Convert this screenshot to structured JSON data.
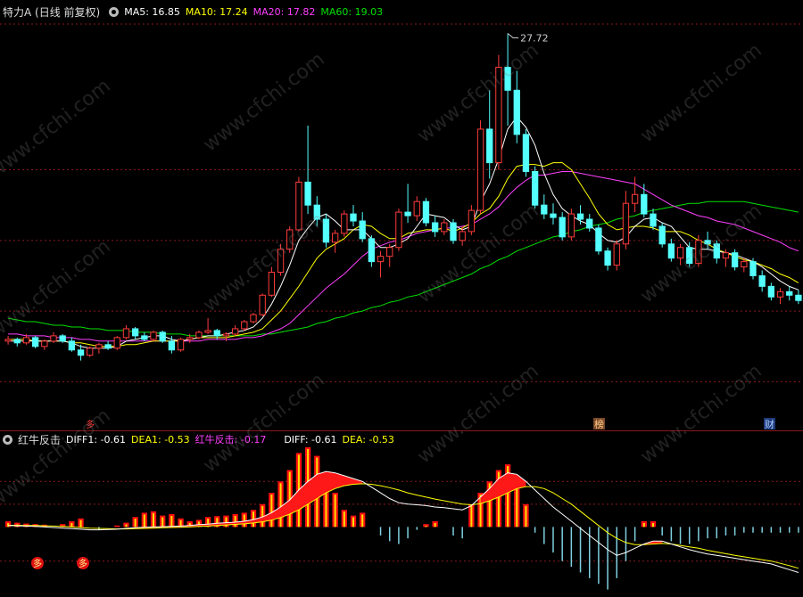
{
  "main_legend": {
    "title": "特力A (日线 前复权)",
    "ma5": "MA5: 16.85",
    "ma10": "MA10: 17.24",
    "ma20": "MA20: 17.82",
    "ma60": "MA60: 19.03"
  },
  "sub_legend": {
    "title": "红牛反击",
    "diff1": "DIFF1: -0.61",
    "dea1": "DEA1: -0.53",
    "hong": "红牛反击: -0.17",
    "diff": "DIFF: -0.61",
    "dea": "DEA: -0.53"
  },
  "peak_label": "27.72",
  "markers": {
    "bang": "榜",
    "cai": "财",
    "duo": "多"
  },
  "watermark": "www.cfchi.com",
  "colors": {
    "up": "#ff3b3b",
    "down": "#54ffff",
    "ma5": "#ffffff",
    "ma10": "#ffff00",
    "ma20": "#ff40ff",
    "ma60": "#00e000",
    "grid": "#8a1a1a"
  },
  "chart_data": {
    "type": "candlestick",
    "main": {
      "title": "特力A (日线 前复权)",
      "ylim": [
        5.5,
        28.5
      ],
      "peak": 27.72,
      "candles": [
        [
          10.3,
          10.6,
          10.1,
          10.4
        ],
        [
          10.4,
          10.5,
          10.0,
          10.2
        ],
        [
          10.2,
          10.7,
          10.1,
          10.5
        ],
        [
          10.5,
          10.6,
          9.9,
          10.0
        ],
        [
          10.0,
          10.4,
          9.8,
          10.3
        ],
        [
          10.3,
          10.8,
          10.2,
          10.6
        ],
        [
          10.6,
          10.7,
          10.2,
          10.3
        ],
        [
          10.3,
          10.5,
          9.7,
          9.8
        ],
        [
          9.8,
          10.1,
          9.2,
          9.5
        ],
        [
          9.5,
          10.0,
          9.4,
          9.9
        ],
        [
          9.9,
          10.2,
          9.6,
          10.1
        ],
        [
          10.1,
          10.3,
          9.8,
          9.9
        ],
        [
          9.9,
          10.6,
          9.8,
          10.5
        ],
        [
          10.5,
          11.2,
          10.4,
          11.0
        ],
        [
          11.0,
          11.1,
          10.4,
          10.6
        ],
        [
          10.6,
          10.8,
          10.3,
          10.4
        ],
        [
          10.4,
          10.9,
          10.3,
          10.8
        ],
        [
          10.8,
          10.9,
          10.2,
          10.3
        ],
        [
          10.3,
          10.6,
          9.6,
          9.8
        ],
        [
          9.8,
          10.5,
          9.7,
          10.4
        ],
        [
          10.4,
          10.7,
          10.2,
          10.5
        ],
        [
          10.5,
          10.9,
          10.4,
          10.8
        ],
        [
          10.8,
          11.6,
          10.7,
          10.9
        ],
        [
          10.9,
          11.0,
          10.4,
          10.6
        ],
        [
          10.6,
          10.8,
          10.3,
          10.7
        ],
        [
          10.7,
          11.2,
          10.6,
          11.0
        ],
        [
          11.0,
          11.5,
          10.9,
          11.4
        ],
        [
          11.4,
          11.9,
          11.3,
          11.8
        ],
        [
          11.8,
          13.0,
          11.7,
          12.9
        ],
        [
          12.9,
          14.5,
          12.8,
          14.2
        ],
        [
          14.2,
          15.8,
          14.0,
          15.5
        ],
        [
          15.5,
          16.8,
          15.3,
          16.6
        ],
        [
          16.6,
          19.6,
          16.5,
          19.3
        ],
        [
          19.3,
          22.5,
          17.5,
          18.0
        ],
        [
          18.0,
          18.5,
          16.8,
          17.2
        ],
        [
          17.2,
          17.5,
          15.6,
          15.9
        ],
        [
          15.9,
          16.6,
          15.3,
          16.4
        ],
        [
          16.4,
          17.7,
          16.2,
          17.5
        ],
        [
          17.5,
          18.0,
          16.8,
          17.1
        ],
        [
          17.1,
          17.6,
          15.9,
          16.1
        ],
        [
          16.1,
          16.3,
          14.5,
          14.8
        ],
        [
          14.8,
          15.4,
          13.9,
          15.1
        ],
        [
          15.1,
          15.8,
          14.5,
          15.6
        ],
        [
          15.6,
          17.8,
          15.4,
          17.6
        ],
        [
          17.6,
          19.2,
          17.0,
          17.4
        ],
        [
          17.4,
          18.5,
          17.1,
          18.2
        ],
        [
          18.2,
          18.4,
          16.8,
          17.0
        ],
        [
          17.0,
          17.4,
          16.2,
          16.5
        ],
        [
          16.5,
          17.2,
          16.3,
          17.0
        ],
        [
          17.0,
          17.2,
          15.8,
          16.0
        ],
        [
          16.0,
          16.8,
          15.7,
          16.5
        ],
        [
          16.5,
          18.0,
          16.3,
          17.7
        ],
        [
          17.7,
          22.8,
          17.5,
          22.3
        ],
        [
          22.3,
          24.5,
          19.5,
          20.4
        ],
        [
          20.4,
          26.5,
          20.0,
          25.8
        ],
        [
          25.8,
          27.72,
          22.5,
          24.5
        ],
        [
          24.5,
          25.6,
          21.5,
          22.0
        ],
        [
          22.0,
          22.3,
          19.6,
          19.9
        ],
        [
          19.9,
          20.2,
          17.8,
          18.0
        ],
        [
          18.0,
          18.6,
          17.2,
          17.5
        ],
        [
          17.5,
          18.1,
          16.9,
          17.3
        ],
        [
          17.3,
          17.6,
          16.0,
          16.2
        ],
        [
          16.2,
          17.8,
          16.0,
          17.5
        ],
        [
          17.5,
          18.0,
          16.9,
          17.2
        ],
        [
          17.2,
          17.5,
          16.5,
          16.7
        ],
        [
          16.7,
          16.9,
          15.2,
          15.4
        ],
        [
          15.4,
          15.6,
          14.3,
          14.6
        ],
        [
          14.6,
          16.0,
          14.3,
          15.8
        ],
        [
          15.8,
          18.8,
          15.5,
          18.1
        ],
        [
          18.1,
          19.6,
          17.6,
          18.6
        ],
        [
          18.6,
          19.2,
          17.3,
          17.5
        ],
        [
          17.5,
          17.8,
          16.6,
          16.8
        ],
        [
          16.8,
          17.0,
          15.6,
          15.8
        ],
        [
          15.8,
          16.1,
          14.8,
          15.0
        ],
        [
          15.0,
          15.8,
          14.6,
          15.6
        ],
        [
          15.6,
          15.9,
          14.5,
          14.7
        ],
        [
          14.7,
          16.3,
          14.5,
          16.0
        ],
        [
          16.0,
          16.5,
          15.5,
          15.8
        ],
        [
          15.8,
          16.0,
          14.7,
          15.0
        ],
        [
          15.0,
          15.5,
          14.5,
          15.3
        ],
        [
          15.3,
          15.5,
          14.3,
          14.5
        ],
        [
          14.5,
          15.0,
          14.2,
          14.8
        ],
        [
          14.8,
          15.0,
          13.8,
          14.0
        ],
        [
          14.0,
          14.3,
          13.1,
          13.4
        ],
        [
          13.4,
          13.6,
          12.6,
          12.8
        ],
        [
          12.8,
          13.3,
          12.4,
          13.1
        ],
        [
          13.1,
          13.4,
          12.6,
          12.9
        ],
        [
          12.9,
          13.2,
          12.4,
          12.6
        ]
      ],
      "ma5": [
        10.3,
        10.3,
        10.3,
        10.3,
        10.3,
        10.3,
        10.3,
        10.2,
        10.0,
        9.9,
        9.9,
        9.9,
        10.0,
        10.3,
        10.4,
        10.5,
        10.6,
        10.6,
        10.4,
        10.3,
        10.4,
        10.5,
        10.6,
        10.6,
        10.7,
        10.8,
        10.9,
        11.1,
        11.6,
        12.4,
        13.4,
        14.6,
        16.0,
        16.7,
        17.3,
        17.5,
        17.1,
        16.6,
        16.6,
        16.6,
        16.1,
        15.6,
        15.6,
        15.8,
        16.1,
        16.8,
        17.5,
        17.4,
        17.3,
        16.9,
        16.6,
        16.8,
        18.2,
        19.2,
        20.6,
        22.3,
        23.0,
        22.4,
        21.4,
        19.8,
        18.6,
        17.8,
        17.4,
        17.1,
        16.9,
        16.4,
        16.0,
        15.9,
        16.2,
        16.8,
        17.2,
        17.3,
        17.0,
        16.8,
        16.2,
        15.6,
        15.5,
        15.5,
        15.4,
        15.3,
        15.2,
        15.0,
        14.8,
        14.5,
        14.1,
        13.7,
        13.4,
        13.2
      ],
      "ma10": [
        10.4,
        10.4,
        10.4,
        10.3,
        10.3,
        10.3,
        10.3,
        10.2,
        10.2,
        10.1,
        10.0,
        10.0,
        10.0,
        10.1,
        10.1,
        10.2,
        10.3,
        10.3,
        10.3,
        10.3,
        10.4,
        10.5,
        10.5,
        10.5,
        10.5,
        10.6,
        10.7,
        10.8,
        11.0,
        11.5,
        12.0,
        12.7,
        13.4,
        14.2,
        15.0,
        15.5,
        15.8,
        16.1,
        16.6,
        16.9,
        16.8,
        16.4,
        16.1,
        16.1,
        16.4,
        16.5,
        16.6,
        16.6,
        16.7,
        16.5,
        16.7,
        17.0,
        17.5,
        17.8,
        18.5,
        19.5,
        20.2,
        20.3,
        20.3,
        20.2,
        20.4,
        20.4,
        20.0,
        19.2,
        18.4,
        17.5,
        16.9,
        16.6,
        16.7,
        16.8,
        16.8,
        16.7,
        16.5,
        16.5,
        16.5,
        16.3,
        16.0,
        15.8,
        15.5,
        15.3,
        15.1,
        14.9,
        14.8,
        14.6,
        14.4,
        14.1,
        13.9,
        13.6
      ],
      "ma20": [
        10.7,
        10.7,
        10.6,
        10.6,
        10.6,
        10.5,
        10.5,
        10.5,
        10.4,
        10.4,
        10.3,
        10.3,
        10.3,
        10.3,
        10.3,
        10.3,
        10.3,
        10.3,
        10.3,
        10.3,
        10.3,
        10.3,
        10.4,
        10.4,
        10.4,
        10.4,
        10.5,
        10.5,
        10.6,
        10.8,
        11.0,
        11.3,
        11.8,
        12.3,
        12.8,
        13.3,
        13.7,
        14.1,
        14.6,
        15.1,
        15.5,
        15.7,
        15.9,
        16.0,
        16.2,
        16.4,
        16.5,
        16.6,
        16.7,
        16.7,
        16.8,
        16.9,
        17.2,
        17.5,
        17.9,
        18.5,
        19.0,
        19.4,
        19.7,
        19.7,
        19.8,
        19.9,
        19.9,
        19.8,
        19.7,
        19.6,
        19.5,
        19.4,
        19.3,
        19.2,
        18.9,
        18.6,
        18.3,
        18.0,
        17.8,
        17.6,
        17.4,
        17.3,
        17.1,
        17.0,
        16.9,
        16.7,
        16.5,
        16.3,
        16.1,
        15.9,
        15.6,
        15.4
      ],
      "ma60": [
        11.6,
        11.5,
        11.4,
        11.4,
        11.3,
        11.2,
        11.2,
        11.1,
        11.1,
        11.0,
        11.0,
        10.9,
        10.9,
        10.9,
        10.8,
        10.8,
        10.8,
        10.7,
        10.7,
        10.7,
        10.6,
        10.6,
        10.6,
        10.6,
        10.6,
        10.6,
        10.6,
        10.6,
        10.7,
        10.7,
        10.8,
        10.9,
        11.0,
        11.1,
        11.3,
        11.4,
        11.6,
        11.7,
        11.9,
        12.0,
        12.2,
        12.3,
        12.5,
        12.6,
        12.8,
        12.9,
        13.1,
        13.3,
        13.5,
        13.7,
        13.9,
        14.1,
        14.4,
        14.6,
        14.9,
        15.1,
        15.4,
        15.6,
        15.8,
        16.0,
        16.2,
        16.3,
        16.5,
        16.6,
        16.8,
        16.9,
        17.0,
        17.2,
        17.3,
        17.4,
        17.6,
        17.7,
        17.8,
        17.9,
        18.0,
        18.1,
        18.1,
        18.2,
        18.2,
        18.2,
        18.2,
        18.2,
        18.1,
        18.0,
        17.9,
        17.8,
        17.7,
        17.6
      ]
    },
    "sub": {
      "title": "红牛反击",
      "ylim": [
        -2.4,
        2.8
      ],
      "diff": [
        0.05,
        0.04,
        0.03,
        0.02,
        0.0,
        -0.02,
        -0.04,
        -0.06,
        -0.08,
        -0.1,
        -0.1,
        -0.09,
        -0.08,
        -0.05,
        -0.03,
        -0.01,
        0.0,
        0.01,
        0.02,
        0.03,
        0.05,
        0.08,
        0.1,
        0.13,
        0.15,
        0.17,
        0.2,
        0.26,
        0.35,
        0.5,
        0.7,
        0.95,
        1.3,
        1.6,
        1.85,
        1.95,
        1.9,
        1.8,
        1.7,
        1.6,
        1.4,
        1.2,
        1.0,
        0.85,
        0.8,
        0.78,
        0.75,
        0.7,
        0.68,
        0.64,
        0.6,
        0.75,
        1.05,
        1.35,
        1.7,
        1.9,
        1.85,
        1.6,
        1.3,
        1.0,
        0.7,
        0.45,
        0.2,
        -0.05,
        -0.3,
        -0.55,
        -0.8,
        -1.0,
        -0.9,
        -0.75,
        -0.6,
        -0.5,
        -0.5,
        -0.6,
        -0.7,
        -0.8,
        -0.88,
        -0.95,
        -1.0,
        -1.05,
        -1.1,
        -1.15,
        -1.2,
        -1.25,
        -1.3,
        -1.4,
        -1.5,
        -1.6
      ],
      "dea": [
        0.06,
        0.06,
        0.05,
        0.05,
        0.04,
        0.03,
        0.02,
        0.0,
        -0.02,
        -0.04,
        -0.05,
        -0.06,
        -0.07,
        -0.07,
        -0.06,
        -0.05,
        -0.04,
        -0.03,
        -0.02,
        -0.01,
        0.0,
        0.02,
        0.03,
        0.05,
        0.07,
        0.09,
        0.11,
        0.14,
        0.18,
        0.24,
        0.33,
        0.45,
        0.6,
        0.8,
        1.0,
        1.2,
        1.35,
        1.45,
        1.5,
        1.52,
        1.5,
        1.45,
        1.38,
        1.3,
        1.2,
        1.12,
        1.05,
        0.98,
        0.92,
        0.86,
        0.8,
        0.78,
        0.82,
        0.92,
        1.05,
        1.2,
        1.35,
        1.42,
        1.42,
        1.35,
        1.2,
        1.0,
        0.8,
        0.55,
        0.3,
        0.05,
        -0.2,
        -0.4,
        -0.55,
        -0.62,
        -0.62,
        -0.6,
        -0.58,
        -0.6,
        -0.65,
        -0.7,
        -0.75,
        -0.82,
        -0.88,
        -0.94,
        -1.0,
        -1.05,
        -1.1,
        -1.15,
        -1.2,
        -1.28,
        -1.36,
        -1.45
      ],
      "bars": [
        0.2,
        0.15,
        0.12,
        0.1,
        0.08,
        0.0,
        0.1,
        0.2,
        0.3,
        0.0,
        -0.1,
        0.0,
        0.05,
        0.15,
        0.35,
        0.5,
        0.55,
        0.4,
        0.45,
        0.3,
        0.2,
        0.25,
        0.35,
        0.38,
        0.4,
        0.45,
        0.5,
        0.6,
        0.8,
        1.2,
        1.6,
        2.0,
        2.6,
        2.8,
        2.5,
        1.8,
        1.2,
        0.6,
        0.4,
        0.5,
        0.0,
        -0.3,
        -0.5,
        -0.6,
        -0.4,
        -0.1,
        0.1,
        0.2,
        0.0,
        -0.3,
        -0.4,
        0.8,
        1.2,
        1.6,
        2.0,
        2.2,
        1.8,
        0.8,
        -0.2,
        -0.6,
        -0.9,
        -1.2,
        -1.4,
        -1.6,
        -1.8,
        -2.0,
        -2.2,
        -1.8,
        -1.2,
        -0.5,
        0.2,
        0.2,
        -0.3,
        -0.5,
        -0.6,
        -0.6,
        -0.5,
        -0.4,
        -0.4,
        -0.3,
        -0.3,
        -0.2,
        -0.2,
        -0.2,
        -0.2,
        -0.2,
        -0.2,
        -0.2
      ]
    }
  }
}
